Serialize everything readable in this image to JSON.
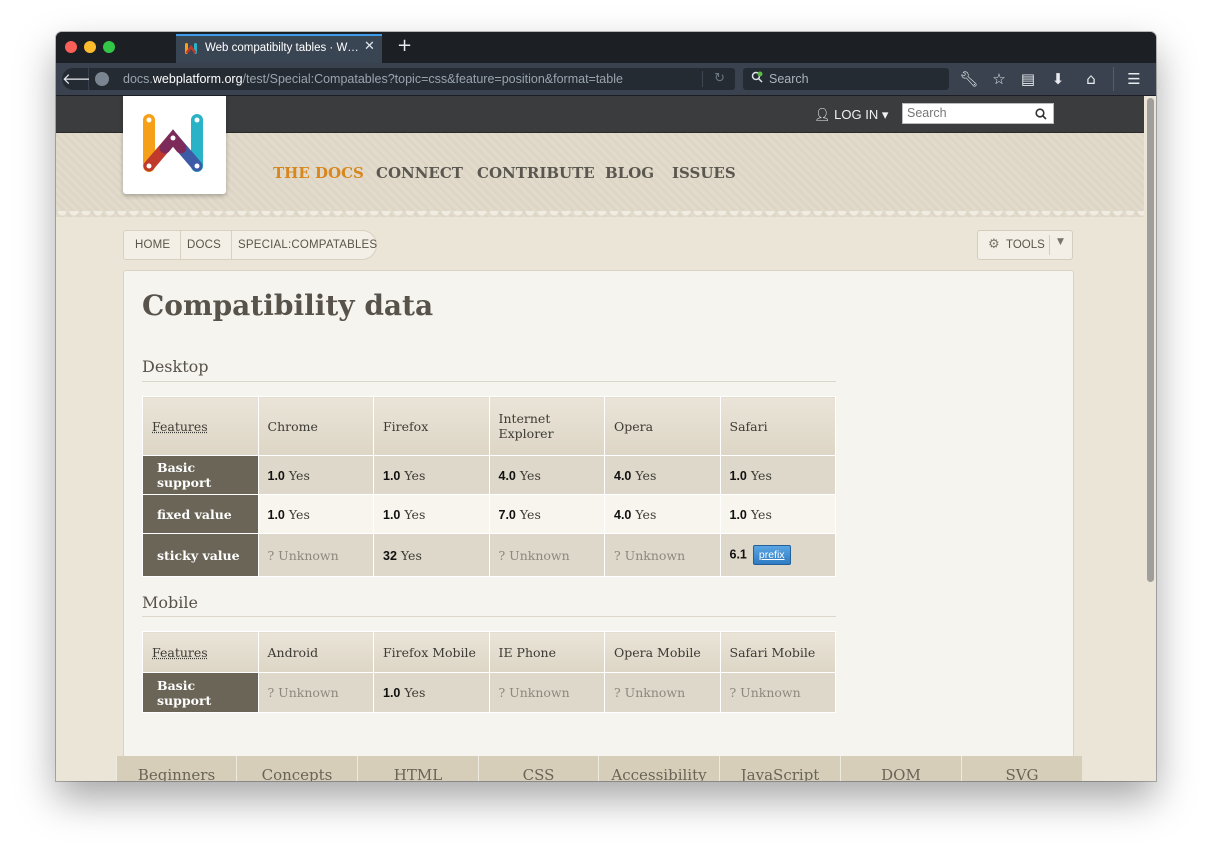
{
  "browser": {
    "tab_title": "Web compatibilty tables · W…",
    "new_tab": "+",
    "url_prefix": "docs.",
    "url_host": "webplatform.org",
    "url_path": "/test/Special:Compatables?topic=css&feature=position&format=table",
    "search_placeholder": "Search"
  },
  "site": {
    "login": "LOG IN",
    "search_placeholder": "Search",
    "nav": [
      "THE DOCS",
      "CONNECT",
      "CONTRIBUTE",
      "BLOG",
      "ISSUES"
    ],
    "breadcrumb": [
      "HOME",
      "DOCS",
      "SPECIAL:COMPATABLES"
    ],
    "tools_label": "TOOLS"
  },
  "page": {
    "title": "Compatibility data",
    "desktop": {
      "heading": "Desktop",
      "columns": [
        "Features",
        "Chrome",
        "Firefox",
        "Internet Explorer",
        "Opera",
        "Safari"
      ],
      "rows": [
        {
          "feature": "Basic support",
          "cells": [
            {
              "ver": "1.0",
              "text": "Yes"
            },
            {
              "ver": "1.0",
              "text": "Yes"
            },
            {
              "ver": "4.0",
              "text": "Yes"
            },
            {
              "ver": "4.0",
              "text": "Yes"
            },
            {
              "ver": "1.0",
              "text": "Yes"
            }
          ]
        },
        {
          "feature": "fixed value",
          "cells": [
            {
              "ver": "1.0",
              "text": "Yes"
            },
            {
              "ver": "1.0",
              "text": "Yes"
            },
            {
              "ver": "7.0",
              "text": "Yes"
            },
            {
              "ver": "4.0",
              "text": "Yes"
            },
            {
              "ver": "1.0",
              "text": "Yes"
            }
          ]
        },
        {
          "feature": "sticky value",
          "cells": [
            {
              "ver": "",
              "text": "? Unknown"
            },
            {
              "ver": "32",
              "text": "Yes"
            },
            {
              "ver": "",
              "text": "? Unknown"
            },
            {
              "ver": "",
              "text": "? Unknown"
            },
            {
              "ver": "6.1",
              "text": "",
              "badge": "prefix"
            }
          ]
        }
      ]
    },
    "mobile": {
      "heading": "Mobile",
      "columns": [
        "Features",
        "Android",
        "Firefox Mobile",
        "IE Phone",
        "Opera Mobile",
        "Safari Mobile"
      ],
      "rows": [
        {
          "feature": "Basic support",
          "cells": [
            {
              "ver": "",
              "text": "? Unknown"
            },
            {
              "ver": "1.0",
              "text": "Yes"
            },
            {
              "ver": "",
              "text": "? Unknown"
            },
            {
              "ver": "",
              "text": "? Unknown"
            },
            {
              "ver": "",
              "text": "? Unknown"
            }
          ]
        }
      ]
    }
  },
  "bottom_tabs": [
    "Beginners",
    "Concepts",
    "HTML",
    "CSS",
    "Accessibility",
    "JavaScript",
    "DOM",
    "SVG"
  ]
}
